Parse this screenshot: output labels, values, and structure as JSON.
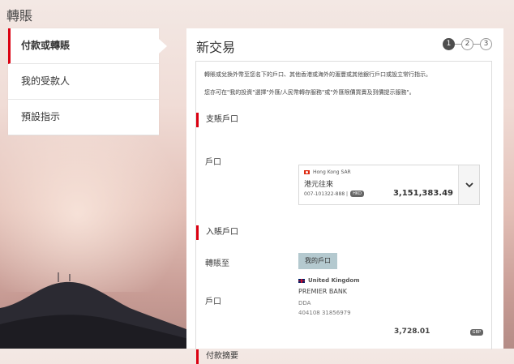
{
  "page": {
    "title": "轉賬"
  },
  "sidebar": {
    "items": [
      {
        "label": "付款或轉賬",
        "active": true
      },
      {
        "label": "我的受款人",
        "active": false
      },
      {
        "label": "預設指示",
        "active": false
      }
    ]
  },
  "panel": {
    "title": "新交易",
    "steps": [
      "1",
      "2",
      "3"
    ],
    "current_step": 1,
    "note1": "轉賬或兌換外幣至您名下的戶口、其他香港或海外的滙豐或其他銀行戶口或設立常行指示。",
    "note2": "您亦可在\"我的投資\"選擇\"外匯/人民幣轉存服務\"或\"外匯限價買賣及到價提示服務\"。",
    "from_section": {
      "heading": "支賬戶口",
      "account_label": "戶口",
      "account": {
        "region": "Hong Kong SAR",
        "name": "港元往來",
        "number": "007-101322-888 |",
        "currency": "HKD",
        "balance": "3,151,383.49"
      }
    },
    "to_section": {
      "heading": "入賬戶口",
      "transfer_to_label": "轉賬至",
      "transfer_to_button": "我的戶口",
      "account_label": "戶口",
      "payee": {
        "country": "United Kingdom",
        "bank": "PREMIER BANK",
        "type": "DDA",
        "number": "404108 31856979",
        "balance": "3,728.01",
        "currency": "GBP"
      }
    },
    "summary_section": {
      "heading": "付款摘要"
    }
  },
  "colors": {
    "accent": "#db0011",
    "toggle": "#b4c9cf"
  }
}
